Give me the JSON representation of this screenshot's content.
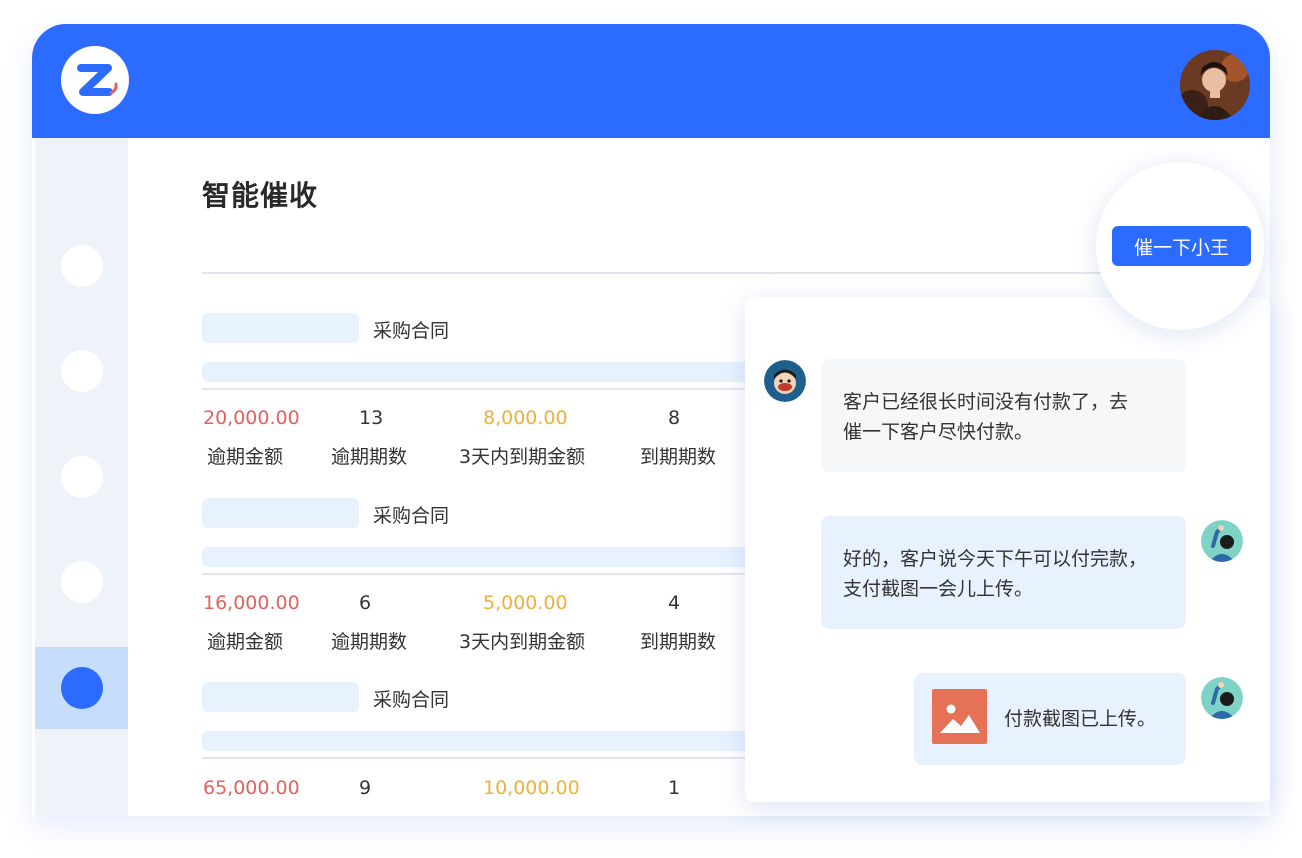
{
  "page": {
    "title": "智能催收"
  },
  "remind_button_label": "催一下小王",
  "contracts": [
    {
      "label": "采购合同",
      "overdue_amount": "20,000.00",
      "overdue_periods": "13",
      "due_in_3_days_amount": "8,000.00",
      "due_periods": "8"
    },
    {
      "label": "采购合同",
      "overdue_amount": "16,000.00",
      "overdue_periods": "6",
      "due_in_3_days_amount": "5,000.00",
      "due_periods": "4"
    },
    {
      "label": "采购合同",
      "overdue_amount": "65,000.00",
      "overdue_periods": "9",
      "due_in_3_days_amount": "10,000.00",
      "due_periods": "1"
    }
  ],
  "stat_labels": {
    "overdue_amount": "逾期金额",
    "overdue_periods": "逾期期数",
    "due_in_3_days_amount": "3天内到期金额",
    "due_periods": "到期期数"
  },
  "chat": {
    "messages": [
      {
        "from": "manager",
        "lines": [
          "客户已经很长时间没有付款了，去",
          "催一下客户尽快付款。"
        ]
      },
      {
        "from": "staff",
        "lines": [
          "好的，客户说今天下午可以付完款，",
          "支付截图一会儿上传。"
        ]
      },
      {
        "from": "staff",
        "text": "付款截图已上传。",
        "attachment_icon": "image-icon"
      }
    ]
  },
  "colors": {
    "brand_blue": "#2b6bff",
    "overdue_red": "#e1625e",
    "due_orange": "#f0b03a",
    "light_blue": "#e8f2fe",
    "sidebar_bg": "#eef2f9"
  },
  "icons": {
    "logo": "z-logo-icon",
    "user": "user-avatar",
    "image": "image-icon"
  }
}
